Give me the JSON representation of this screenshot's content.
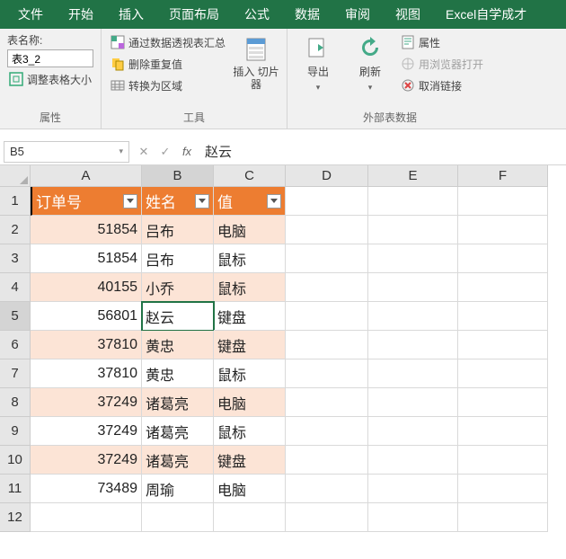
{
  "menu": {
    "file": "文件",
    "home": "开始",
    "insert": "插入",
    "layout": "页面布局",
    "formula": "公式",
    "data": "数据",
    "review": "审阅",
    "view": "视图",
    "custom": "Excel自学成才"
  },
  "ribbon": {
    "props": {
      "tableNameLabel": "表名称:",
      "tableName": "表3_2",
      "resize": "调整表格大小",
      "group": "属性"
    },
    "tools": {
      "pivot": "通过数据透视表汇总",
      "dedup": "删除重复值",
      "range": "转换为区域",
      "slicer": "插入\n切片器",
      "group": "工具"
    },
    "ext": {
      "export": "导出",
      "refresh": "刷新",
      "prop": "属性",
      "browser": "用浏览器打开",
      "unlink": "取消链接",
      "group": "外部表数据"
    }
  },
  "formula": {
    "ref": "B5",
    "value": "赵云"
  },
  "cols": [
    "A",
    "B",
    "C",
    "D",
    "E",
    "F"
  ],
  "headers": {
    "c1": "订单号",
    "c2": "姓名",
    "c3": "值"
  },
  "rows": [
    {
      "n": "2",
      "a": "51854",
      "b": "吕布",
      "c": "电脑",
      "band": true
    },
    {
      "n": "3",
      "a": "51854",
      "b": "吕布",
      "c": "鼠标",
      "band": false
    },
    {
      "n": "4",
      "a": "40155",
      "b": "小乔",
      "c": "鼠标",
      "band": true
    },
    {
      "n": "5",
      "a": "56801",
      "b": "赵云",
      "c": "键盘",
      "band": false,
      "active": true
    },
    {
      "n": "6",
      "a": "37810",
      "b": "黄忠",
      "c": "键盘",
      "band": true
    },
    {
      "n": "7",
      "a": "37810",
      "b": "黄忠",
      "c": "鼠标",
      "band": false
    },
    {
      "n": "8",
      "a": "37249",
      "b": "诸葛亮",
      "c": "电脑",
      "band": true
    },
    {
      "n": "9",
      "a": "37249",
      "b": "诸葛亮",
      "c": "鼠标",
      "band": false
    },
    {
      "n": "10",
      "a": "37249",
      "b": "诸葛亮",
      "c": "键盘",
      "band": true
    },
    {
      "n": "11",
      "a": "73489",
      "b": "周瑜",
      "c": "电脑",
      "band": false
    }
  ],
  "chart_data": {
    "type": "table",
    "columns": [
      "订单号",
      "姓名",
      "值"
    ],
    "data": [
      [
        51854,
        "吕布",
        "电脑"
      ],
      [
        51854,
        "吕布",
        "鼠标"
      ],
      [
        40155,
        "小乔",
        "鼠标"
      ],
      [
        56801,
        "赵云",
        "键盘"
      ],
      [
        37810,
        "黄忠",
        "键盘"
      ],
      [
        37810,
        "黄忠",
        "鼠标"
      ],
      [
        37249,
        "诸葛亮",
        "电脑"
      ],
      [
        37249,
        "诸葛亮",
        "鼠标"
      ],
      [
        37249,
        "诸葛亮",
        "键盘"
      ],
      [
        73489,
        "周瑜",
        "电脑"
      ]
    ]
  }
}
